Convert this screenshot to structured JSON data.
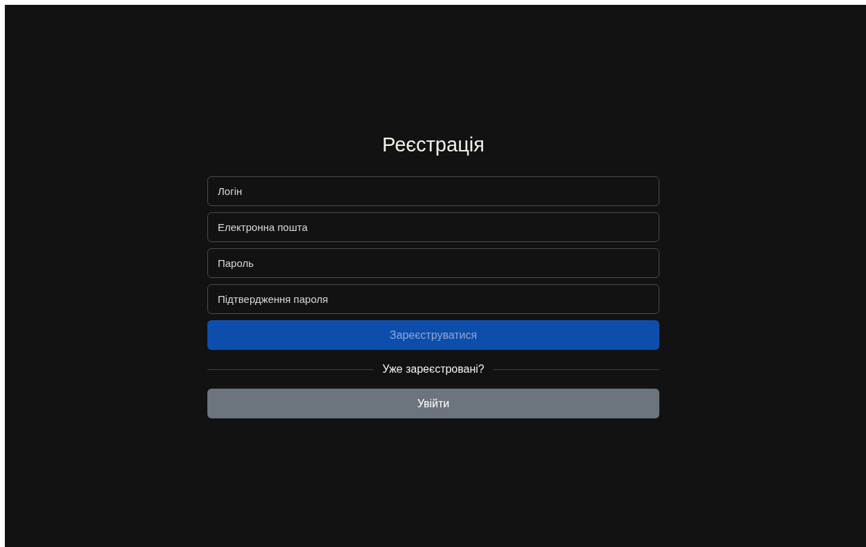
{
  "title": "Реєстрація",
  "fields": [
    {
      "placeholder": "Логін"
    },
    {
      "placeholder": "Електронна пошта"
    },
    {
      "placeholder": "Пароль"
    },
    {
      "placeholder": "Підтвердження пароля"
    }
  ],
  "submit": {
    "label": "Зареєструватися",
    "disabled": true
  },
  "divider_text": "Уже зареєстровані?",
  "login": {
    "label": "Увійти"
  }
}
